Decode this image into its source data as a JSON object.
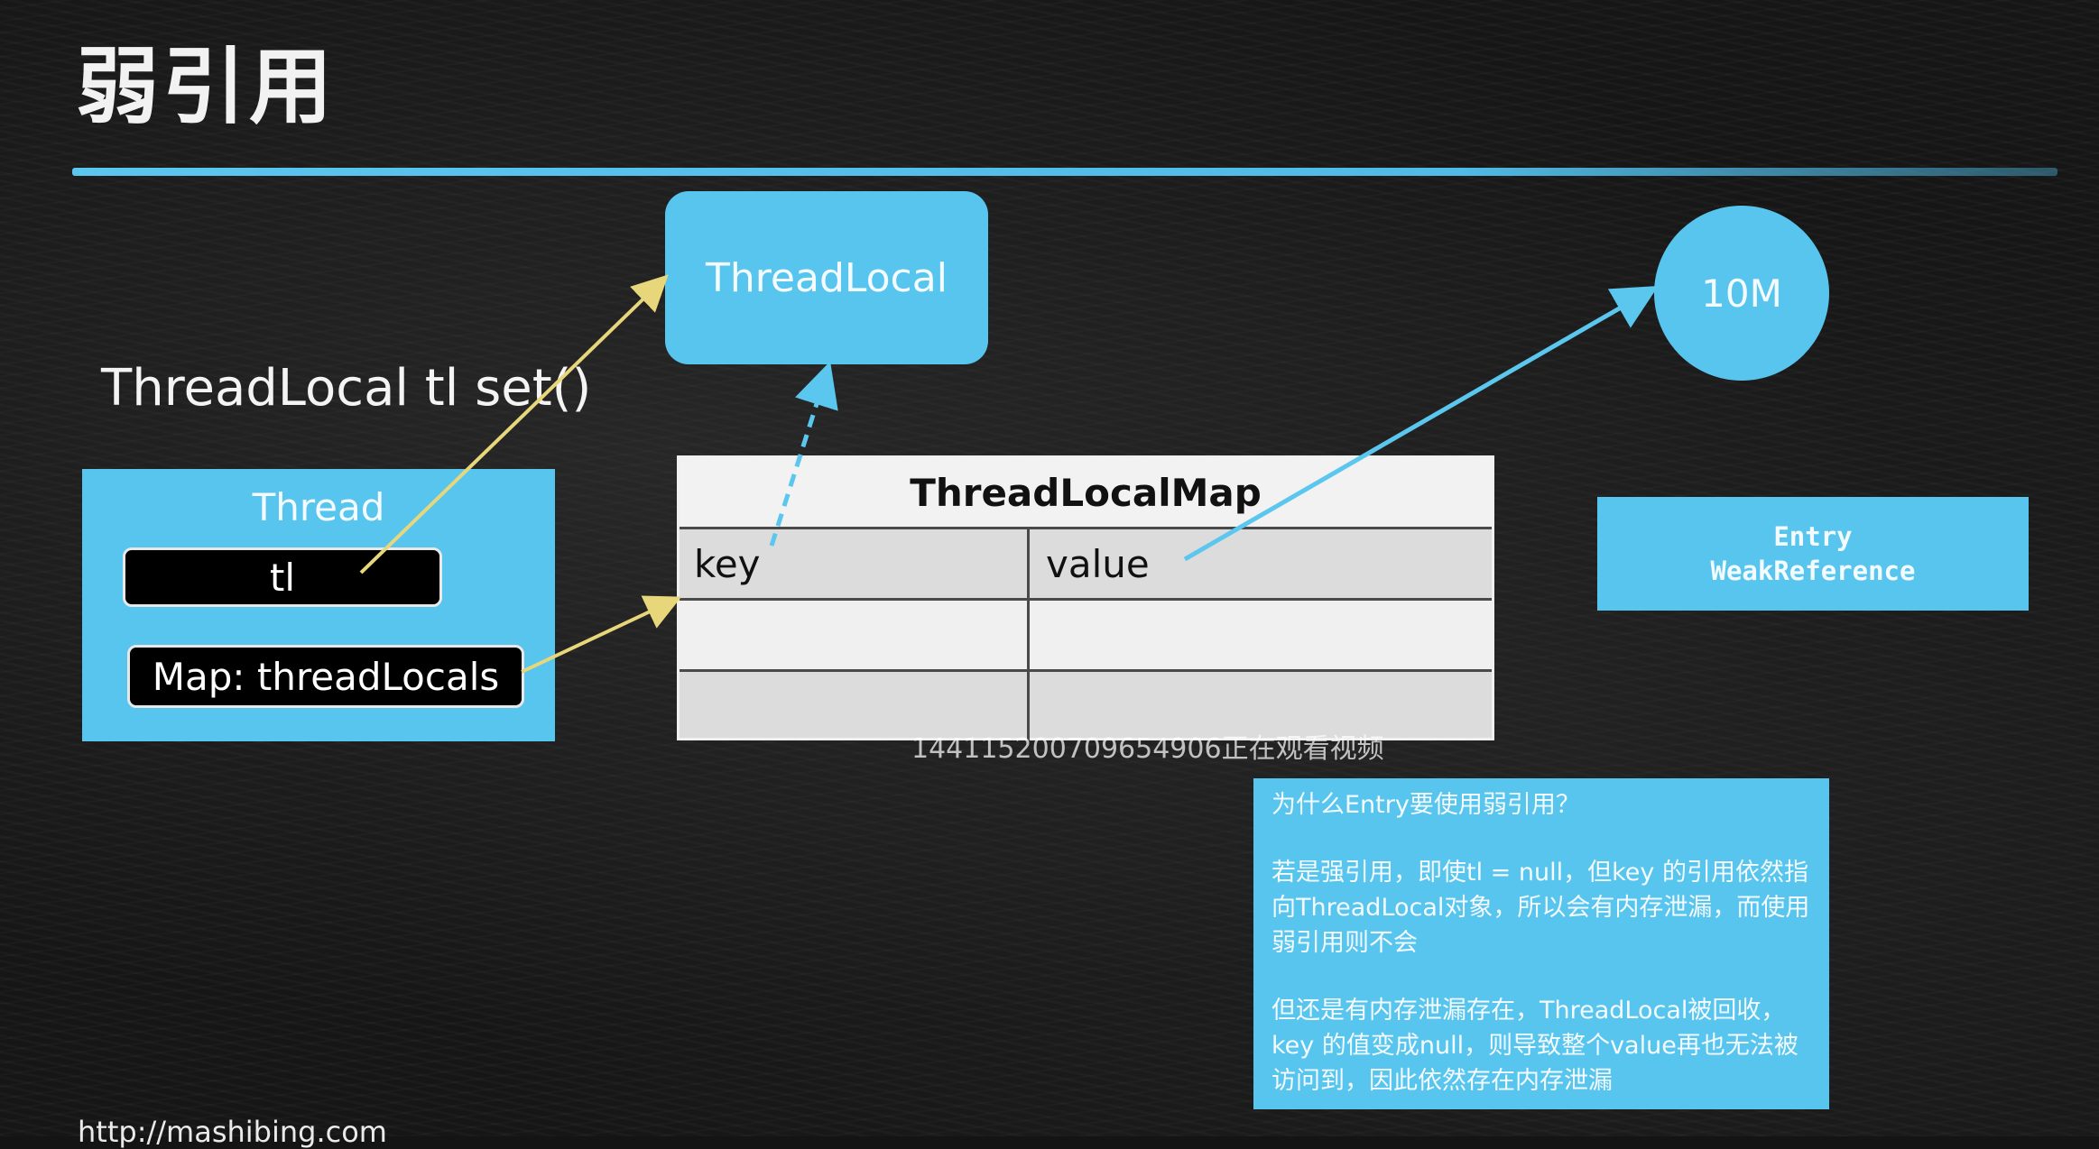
{
  "title": "弱引用",
  "caption": "ThreadLocal tl set()",
  "threadlocal_label": "ThreadLocal",
  "memory_label": "10M",
  "thread": {
    "label": "Thread",
    "tl_label": "tl",
    "map_label": "Map: threadLocals"
  },
  "map_table": {
    "title": "ThreadLocalMap",
    "key_header": "key",
    "value_header": "value"
  },
  "entry": {
    "line1": "Entry",
    "line2": "WeakReference"
  },
  "watermark": "1441152007096549​06正在观看视频",
  "explanation": {
    "question": "为什么Entry要使用弱引用？",
    "para1": "若是强引用，即使tl = null，但key 的引用依然指向ThreadLocal对象，所以会有内存泄漏，而使用弱引用则不会",
    "para2": "但还是有内存泄漏存在，ThreadLocal被回收，key 的值变成null，则导致整个value再也无法被访问到，因此依然存在内存泄漏"
  },
  "url": "http://mashibing.com",
  "colors": {
    "accent_blue": "#58c5ef",
    "arrow_yellow": "#e8d77a",
    "arrow_blue": "#5bc6ee",
    "background": "#161616"
  }
}
